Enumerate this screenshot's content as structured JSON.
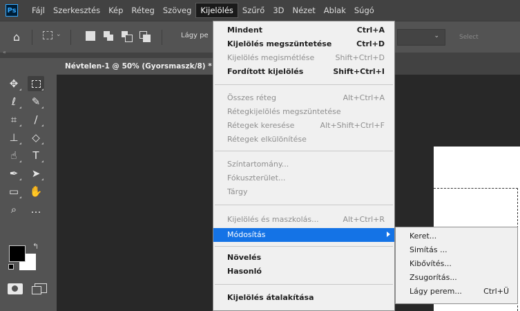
{
  "app": {
    "logo": "Ps"
  },
  "menubar": {
    "items": [
      "Fájl",
      "Szerkesztés",
      "Kép",
      "Réteg",
      "Szöveg",
      "Kijelölés",
      "Szűrő",
      "3D",
      "Nézet",
      "Ablak",
      "Súgó"
    ],
    "active_index": 5
  },
  "options": {
    "feather_label": "Lágy pe",
    "select_label": "Select"
  },
  "document": {
    "tab_title": "Névtelen-1 @ 50% (Gyorsmaszk/8) *"
  },
  "colors": {
    "foreground": "#000000",
    "background": "#ffffff",
    "highlight": "#1473e6",
    "menu_bg": "#f0f0f0"
  },
  "select_menu": {
    "items": [
      {
        "label": "Mindent",
        "shortcut": "Ctrl+A",
        "style": "bold"
      },
      {
        "label": "Kijelölés megszüntetése",
        "shortcut": "Ctrl+D",
        "style": "bold"
      },
      {
        "label": "Kijelölés megismétlése",
        "shortcut": "Shift+Ctrl+D",
        "style": "disabled"
      },
      {
        "label": "Fordított kijelölés",
        "shortcut": "Shift+Ctrl+I",
        "style": "bold"
      },
      {
        "label": "Összes réteg",
        "shortcut": "Alt+Ctrl+A",
        "style": "disabled"
      },
      {
        "label": "Rétegkijelölés megszüntetése",
        "shortcut": "",
        "style": "disabled"
      },
      {
        "label": "Rétegek keresése",
        "shortcut": "Alt+Shift+Ctrl+F",
        "style": "disabled"
      },
      {
        "label": "Rétegek elkülönítése",
        "shortcut": "",
        "style": "disabled"
      },
      {
        "label": "Színtartomány...",
        "shortcut": "",
        "style": "disabled"
      },
      {
        "label": "Fókuszterület...",
        "shortcut": "",
        "style": "disabled"
      },
      {
        "label": "Tárgy",
        "shortcut": "",
        "style": "disabled"
      },
      {
        "label": "Kijelölés és maszkolás...",
        "shortcut": "Alt+Ctrl+R",
        "style": "disabled"
      },
      {
        "label": "Módosítás",
        "shortcut": "",
        "style": "highlighted"
      },
      {
        "label": "Növelés",
        "shortcut": "",
        "style": "bold"
      },
      {
        "label": "Hasonló",
        "shortcut": "",
        "style": "bold"
      },
      {
        "label": "Kijelölés átalakítása",
        "shortcut": "",
        "style": "bold"
      }
    ]
  },
  "modify_submenu": {
    "items": [
      {
        "label": "Keret...",
        "shortcut": ""
      },
      {
        "label": "Simítás ...",
        "shortcut": ""
      },
      {
        "label": "Kibővítés...",
        "shortcut": ""
      },
      {
        "label": "Zsugorítás...",
        "shortcut": ""
      },
      {
        "label": "Lágy perem...",
        "shortcut": "Ctrl+Ü"
      }
    ]
  },
  "tools": [
    "move-icon",
    "marquee-icon",
    "lasso-icon",
    "quick-select-icon",
    "crop-icon",
    "brush-icon",
    "stamp-icon",
    "eraser-icon",
    "smudge-icon",
    "type-icon",
    "pen-icon",
    "path-select-icon",
    "rectangle-icon",
    "hand-icon",
    "zoom-icon",
    "more-icon"
  ]
}
